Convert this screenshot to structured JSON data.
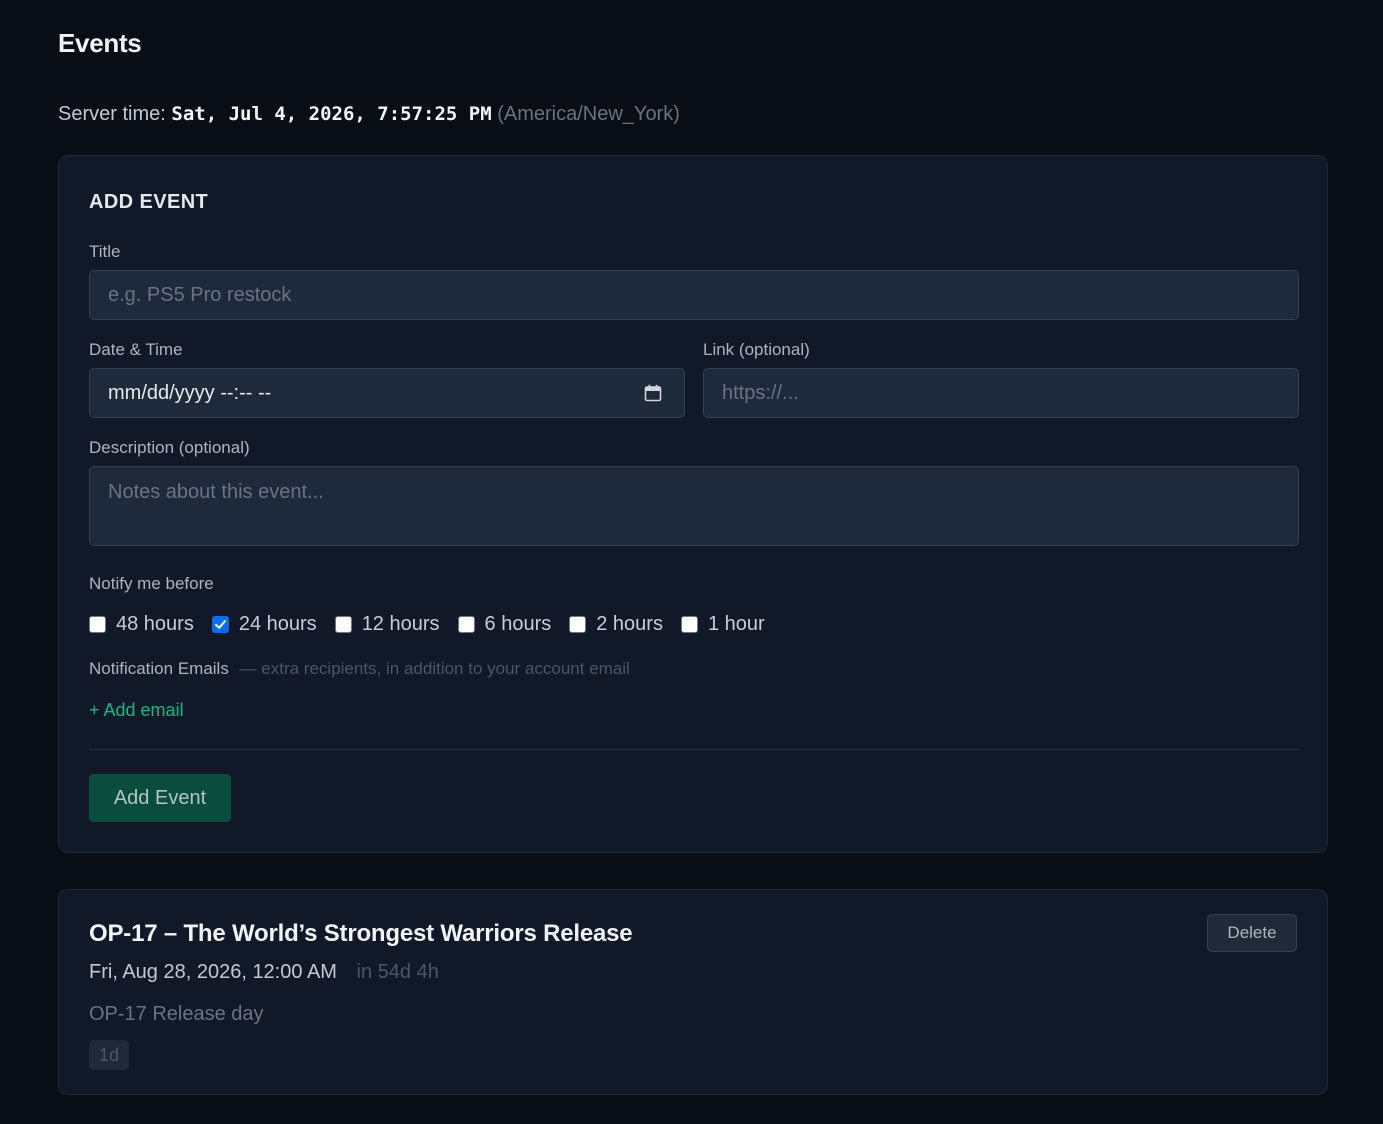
{
  "page": {
    "title": "Events",
    "server_time_label": "Server time:",
    "server_time_value": "Sat, Jul 4, 2026, 7:57:25 PM",
    "server_timezone": "(America/New_York)"
  },
  "add_event": {
    "section_title": "ADD EVENT",
    "title_label": "Title",
    "title_placeholder": "e.g. PS5 Pro restock",
    "datetime_label": "Date & Time",
    "datetime_value": "mm/dd/yyyy --:-- --",
    "link_label": "Link (optional)",
    "link_placeholder": "https://...",
    "description_label": "Description (optional)",
    "description_placeholder": "Notes about this event...",
    "notify_label": "Notify me before",
    "notify_options": [
      {
        "label": "48 hours",
        "checked": false
      },
      {
        "label": "24 hours",
        "checked": true
      },
      {
        "label": "12 hours",
        "checked": false
      },
      {
        "label": "6 hours",
        "checked": false
      },
      {
        "label": "2 hours",
        "checked": false
      },
      {
        "label": "1 hour",
        "checked": false
      }
    ],
    "emails_label": "Notification Emails",
    "emails_hint": "— extra recipients, in addition to your account email",
    "add_email_label": "+ Add email",
    "submit_label": "Add Event"
  },
  "events": [
    {
      "title": "OP-17 – The World’s Strongest Warriors Release",
      "datetime": "Fri, Aug 28, 2026, 12:00 AM",
      "relative": "in 54d 4h",
      "description": "OP-17 Release day",
      "badge": "1d",
      "delete_label": "Delete"
    }
  ],
  "colors": {
    "background": "#090d16",
    "card": "#111827",
    "accent": "#10b981",
    "primary_button": "#0a4d3e",
    "checkbox_checked": "#0b6cf0"
  },
  "icons": {
    "datetime_picker": "calendar-icon",
    "checked_box": "checkmark-icon"
  }
}
